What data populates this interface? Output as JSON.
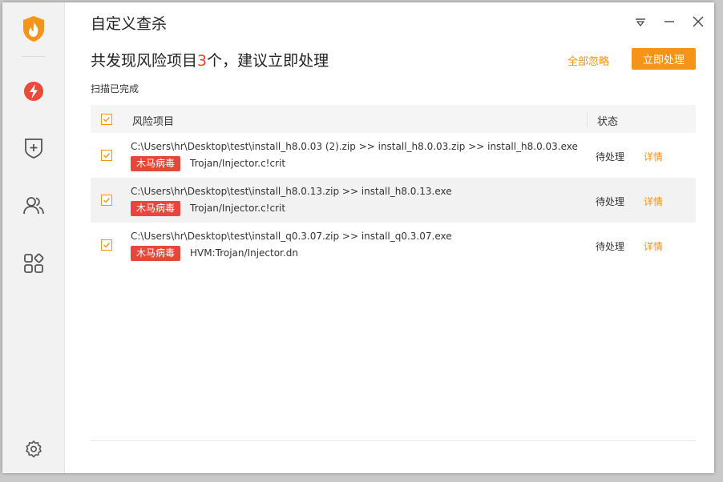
{
  "window": {
    "title": "自定义查杀"
  },
  "headline": {
    "prefix": "共发现风险项目",
    "count": "3",
    "suffix": "个，建议立即处理"
  },
  "actions": {
    "ignore_all": "全部忽略",
    "fix_now": "立即处理"
  },
  "scan_status": "扫描已完成",
  "table": {
    "columns": [
      "风险项目",
      "状态"
    ],
    "rows": [
      {
        "checked": true,
        "path": "C:\\Users\\hr\\Desktop\\test\\install_h8.0.03 (2).zip >> install_h8.0.03.zip >> install_h8.0.03.exe",
        "tag": "木马病毒",
        "virus": "Trojan/Injector.c!crit",
        "status": "待处理",
        "detail": "详情"
      },
      {
        "checked": true,
        "path": "C:\\Users\\hr\\Desktop\\test\\install_h8.0.13.zip >> install_h8.0.13.exe",
        "tag": "木马病毒",
        "virus": "Trojan/Injector.c!crit",
        "status": "待处理",
        "detail": "详情"
      },
      {
        "checked": true,
        "path": "C:\\Users\\hr\\Desktop\\test\\install_q0.3.07.zip >> install_q0.3.07.exe",
        "tag": "木马病毒",
        "virus": "HVM:Trojan/Injector.dn",
        "status": "待处理",
        "detail": "详情"
      }
    ]
  },
  "sidebar": {
    "items": [
      {
        "icon": "lightning-icon"
      },
      {
        "icon": "shield-plus-icon"
      },
      {
        "icon": "users-icon"
      },
      {
        "icon": "apps-icon"
      },
      {
        "icon": "gear-icon"
      }
    ]
  },
  "colors": {
    "accent": "#f6941a",
    "danger": "#e6473a",
    "count": "#e5442b"
  }
}
